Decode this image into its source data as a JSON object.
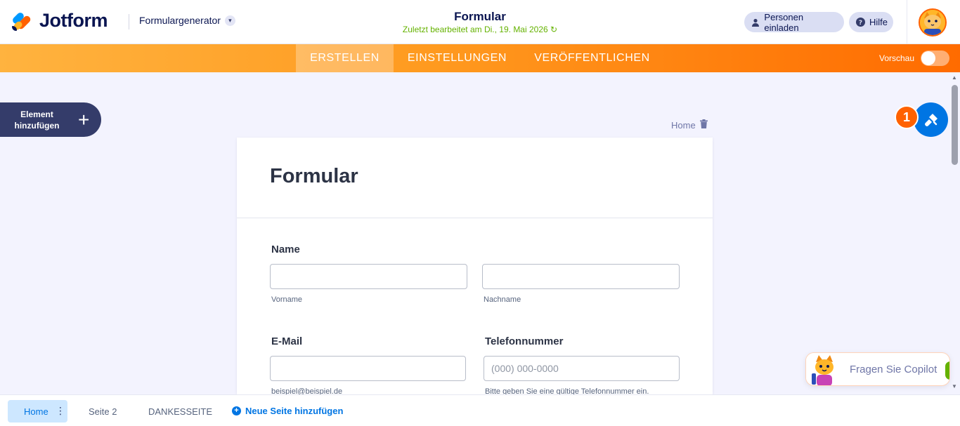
{
  "header": {
    "brand": "Jotform",
    "product_switch": "Formulargenerator",
    "form_title": "Formular",
    "last_edited": "Zuletzt bearbeitet am Di., 19. Mai 2026",
    "invite_label": "Personen einladen",
    "help_label": "Hilfe"
  },
  "nav": {
    "tabs": [
      {
        "label": "ERSTELLEN",
        "active": true
      },
      {
        "label": "EINSTELLUNGEN",
        "active": false
      },
      {
        "label": "VERÖFFENTLICHEN",
        "active": false
      }
    ],
    "preview_label": "Vorschau",
    "preview_on": false
  },
  "sidebar": {
    "add_element_line1": "Element",
    "add_element_line2": "hinzufügen"
  },
  "designer": {
    "badge_count": "1"
  },
  "page_label": "Home",
  "form": {
    "title": "Formular",
    "name_label": "Name",
    "first_name_sub": "Vorname",
    "last_name_sub": "Nachname",
    "email_label": "E-Mail",
    "email_sub": "beispiel@beispiel.de",
    "phone_label": "Telefonnummer",
    "phone_placeholder": "(000) 000-0000",
    "phone_sub": "Bitte geben Sie eine gültige Telefonnummer ein."
  },
  "pages": {
    "items": [
      "Home",
      "Seite 2",
      "DANKESSEITE"
    ],
    "add_label": "Neue Seite hinzufügen"
  },
  "copilot": {
    "label": "Fragen Sie Copilot"
  },
  "colors": {
    "brand_navy": "#0a1551",
    "accent_orange": "#ff6100",
    "accent_blue": "#0075e3",
    "edited_green": "#64b200"
  }
}
